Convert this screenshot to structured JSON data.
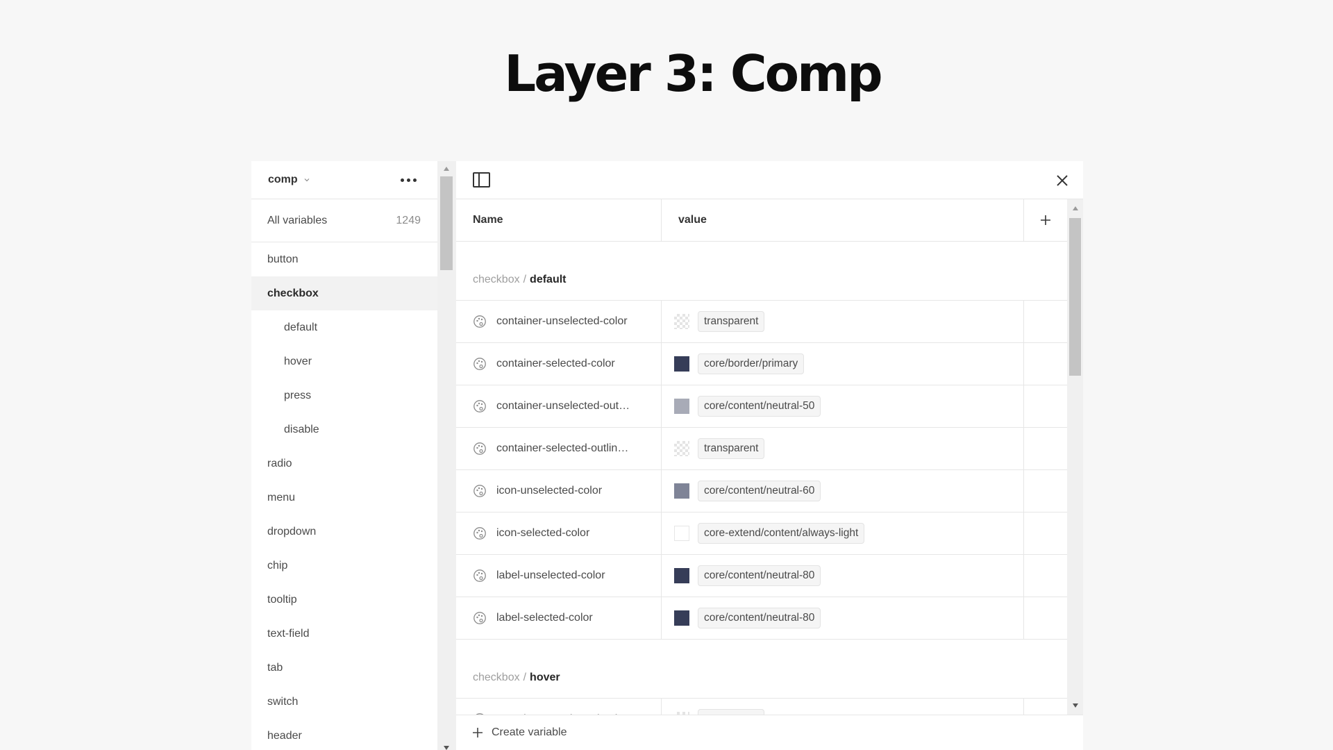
{
  "page_title": "Layer 3: Comp",
  "sidebar": {
    "collection": "comp",
    "all_variables_label": "All variables",
    "all_variables_count": "1249",
    "items": [
      {
        "label": "button",
        "level": 0,
        "active": false
      },
      {
        "label": "checkbox",
        "level": 0,
        "active": true
      },
      {
        "label": "default",
        "level": 1,
        "active": false
      },
      {
        "label": "hover",
        "level": 1,
        "active": false
      },
      {
        "label": "press",
        "level": 1,
        "active": false
      },
      {
        "label": "disable",
        "level": 1,
        "active": false
      },
      {
        "label": "radio",
        "level": 0,
        "active": false
      },
      {
        "label": "menu",
        "level": 0,
        "active": false
      },
      {
        "label": "dropdown",
        "level": 0,
        "active": false
      },
      {
        "label": "chip",
        "level": 0,
        "active": false
      },
      {
        "label": "tooltip",
        "level": 0,
        "active": false
      },
      {
        "label": "text-field",
        "level": 0,
        "active": false
      },
      {
        "label": "tab",
        "level": 0,
        "active": false
      },
      {
        "label": "switch",
        "level": 0,
        "active": false
      },
      {
        "label": "header",
        "level": 0,
        "active": false
      }
    ]
  },
  "table": {
    "columns": {
      "name": "Name",
      "value": "value"
    },
    "groups": [
      {
        "path": "checkbox",
        "separator": "/",
        "name": "default",
        "rows": [
          {
            "name": "container-unselected-color",
            "swatch": "transparent",
            "color": "",
            "value": "transparent"
          },
          {
            "name": "container-selected-color",
            "swatch": "solid",
            "color": "#363d58",
            "value": "core/border/primary"
          },
          {
            "name": "container-unselected-out…",
            "swatch": "solid",
            "color": "#a8abb7",
            "value": "core/content/neutral-50"
          },
          {
            "name": "container-selected-outlin…",
            "swatch": "transparent",
            "color": "",
            "value": "transparent"
          },
          {
            "name": "icon-unselected-color",
            "swatch": "solid",
            "color": "#7f8497",
            "value": "core/content/neutral-60"
          },
          {
            "name": "icon-selected-color",
            "swatch": "light",
            "color": "#ffffff",
            "value": "core-extend/content/always-light"
          },
          {
            "name": "label-unselected-color",
            "swatch": "solid",
            "color": "#363d58",
            "value": "core/content/neutral-80"
          },
          {
            "name": "label-selected-color",
            "swatch": "solid",
            "color": "#363d58",
            "value": "core/content/neutral-80"
          }
        ]
      },
      {
        "path": "checkbox",
        "separator": "/",
        "name": "hover",
        "rows": [
          {
            "name": "container-unselected-color",
            "swatch": "transparent",
            "color": "",
            "value": "transparent"
          }
        ]
      }
    ]
  },
  "footer": {
    "create_label": "Create variable"
  }
}
